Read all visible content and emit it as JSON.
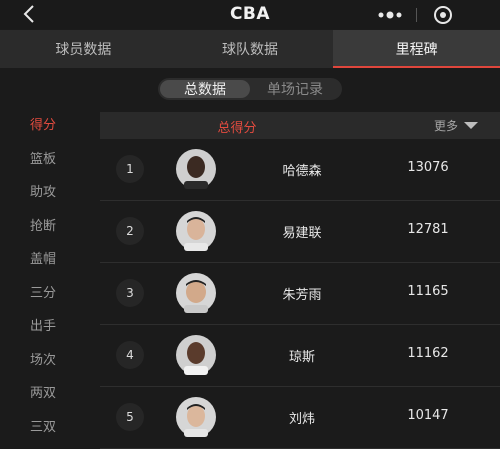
{
  "header": {
    "title": "CBA"
  },
  "tabs": [
    {
      "label": "球员数据"
    },
    {
      "label": "球队数据"
    },
    {
      "label": "里程碑"
    }
  ],
  "toggle": [
    {
      "label": "总数据"
    },
    {
      "label": "单场记录"
    }
  ],
  "categories": [
    {
      "label": "得分"
    },
    {
      "label": "篮板"
    },
    {
      "label": "助攻"
    },
    {
      "label": "抢断"
    },
    {
      "label": "盖帽"
    },
    {
      "label": "三分"
    },
    {
      "label": "出手"
    },
    {
      "label": "场次"
    },
    {
      "label": "两双"
    },
    {
      "label": "三双"
    }
  ],
  "table": {
    "title": "总得分",
    "more_label": "更多",
    "rows": [
      {
        "rank": "1",
        "name": "哈德森",
        "value": "13076"
      },
      {
        "rank": "2",
        "name": "易建联",
        "value": "12781"
      },
      {
        "rank": "3",
        "name": "朱芳雨",
        "value": "11165"
      },
      {
        "rank": "4",
        "name": "琼斯",
        "value": "11162"
      },
      {
        "rank": "5",
        "name": "刘炜",
        "value": "10147"
      }
    ]
  },
  "colors": {
    "accent": "#e24b3f",
    "background": "#1b1b1b"
  },
  "icons": {
    "back": "chevron-left-icon",
    "more": "dots-icon",
    "close": "target-icon"
  }
}
